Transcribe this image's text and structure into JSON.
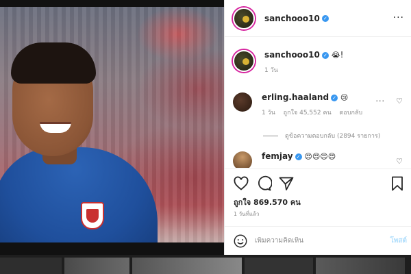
{
  "post": {
    "author": "sanchooo10",
    "caption_emoji": "😭",
    "caption_suffix": "!",
    "caption_age": "1 วัน",
    "more_label": "···"
  },
  "comments": [
    {
      "username": "erling.haaland",
      "emoji": "😢",
      "age": "1 วัน",
      "likes": "ถูกใจ 45,552 คน",
      "reply": "ตอบกลับ",
      "view_replies": "ดูข้อความตอบกลับ (2894 รายการ)"
    },
    {
      "username": "femjay",
      "emoji": "😍😍😍😍"
    }
  ],
  "stats": {
    "likes": "ถูกใจ 869.570 คน",
    "time": "1 วันที่แล้ว"
  },
  "composer": {
    "placeholder": "เพิ่มความคิดเห็น",
    "post_label": "โพสต์"
  },
  "icons": [
    "verified-badge-icon",
    "heart-icon",
    "comment-icon",
    "share-icon",
    "bookmark-icon",
    "emoji-smile-icon",
    "more-options-icon"
  ],
  "colors": {
    "verified": "#3897f0",
    "post_disabled": "#b2dffc",
    "meta_gray": "#8e8e8e"
  }
}
